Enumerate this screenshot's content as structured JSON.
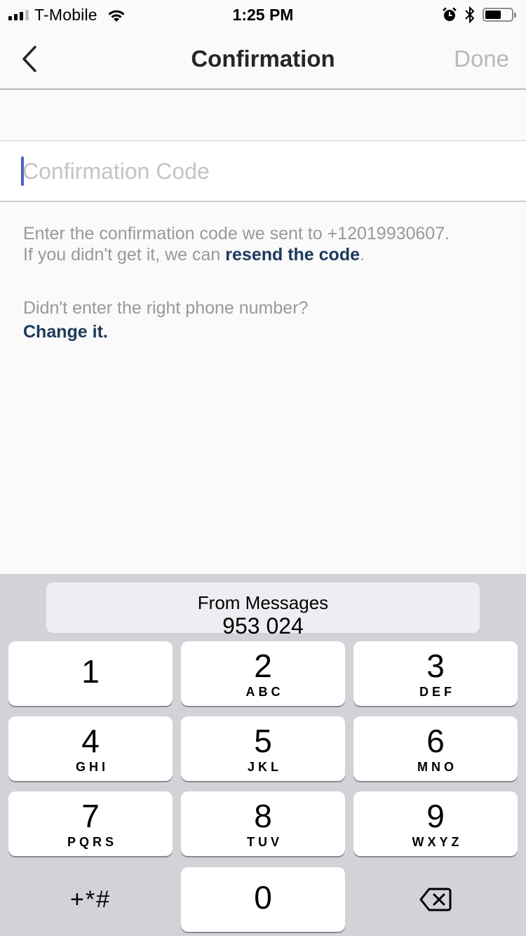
{
  "status_bar": {
    "carrier": "T-Mobile",
    "time": "1:25 PM",
    "signal_bars": 3,
    "signal_bars_total": 4,
    "battery_percent": 60,
    "icons": [
      "signal-icon",
      "wifi-icon",
      "alarm-icon",
      "bluetooth-icon",
      "battery-icon"
    ]
  },
  "nav": {
    "back_icon": "chevron-left-icon",
    "title": "Confirmation",
    "done_label": "Done"
  },
  "input": {
    "value": "",
    "placeholder": "Confirmation Code"
  },
  "help": {
    "line1": "Enter the confirmation code we sent to +12019930607.",
    "line2_prefix": "If you didn't get it, we can ",
    "resend_link": "resend the code",
    "line2_suffix": ".",
    "wrong_number": "Didn't enter the right phone number?",
    "change_link": "Change it."
  },
  "keyboard": {
    "suggestion": {
      "label": "From Messages",
      "code": "953 024"
    },
    "keys": [
      {
        "digit": "1",
        "letters": ""
      },
      {
        "digit": "2",
        "letters": "ABC"
      },
      {
        "digit": "3",
        "letters": "DEF"
      },
      {
        "digit": "4",
        "letters": "GHI"
      },
      {
        "digit": "5",
        "letters": "JKL"
      },
      {
        "digit": "6",
        "letters": "MNO"
      },
      {
        "digit": "7",
        "letters": "PQRS"
      },
      {
        "digit": "8",
        "letters": "TUV"
      },
      {
        "digit": "9",
        "letters": "WXYZ"
      },
      {
        "digit": "0",
        "letters": ""
      }
    ],
    "symbols_label": "+*#",
    "delete_icon": "backspace-icon"
  },
  "colors": {
    "link": "#1d3a5c",
    "caret": "#4a63c4",
    "done_disabled": "#b8b8b8",
    "keyboard_bg": "#d1d3d8"
  }
}
